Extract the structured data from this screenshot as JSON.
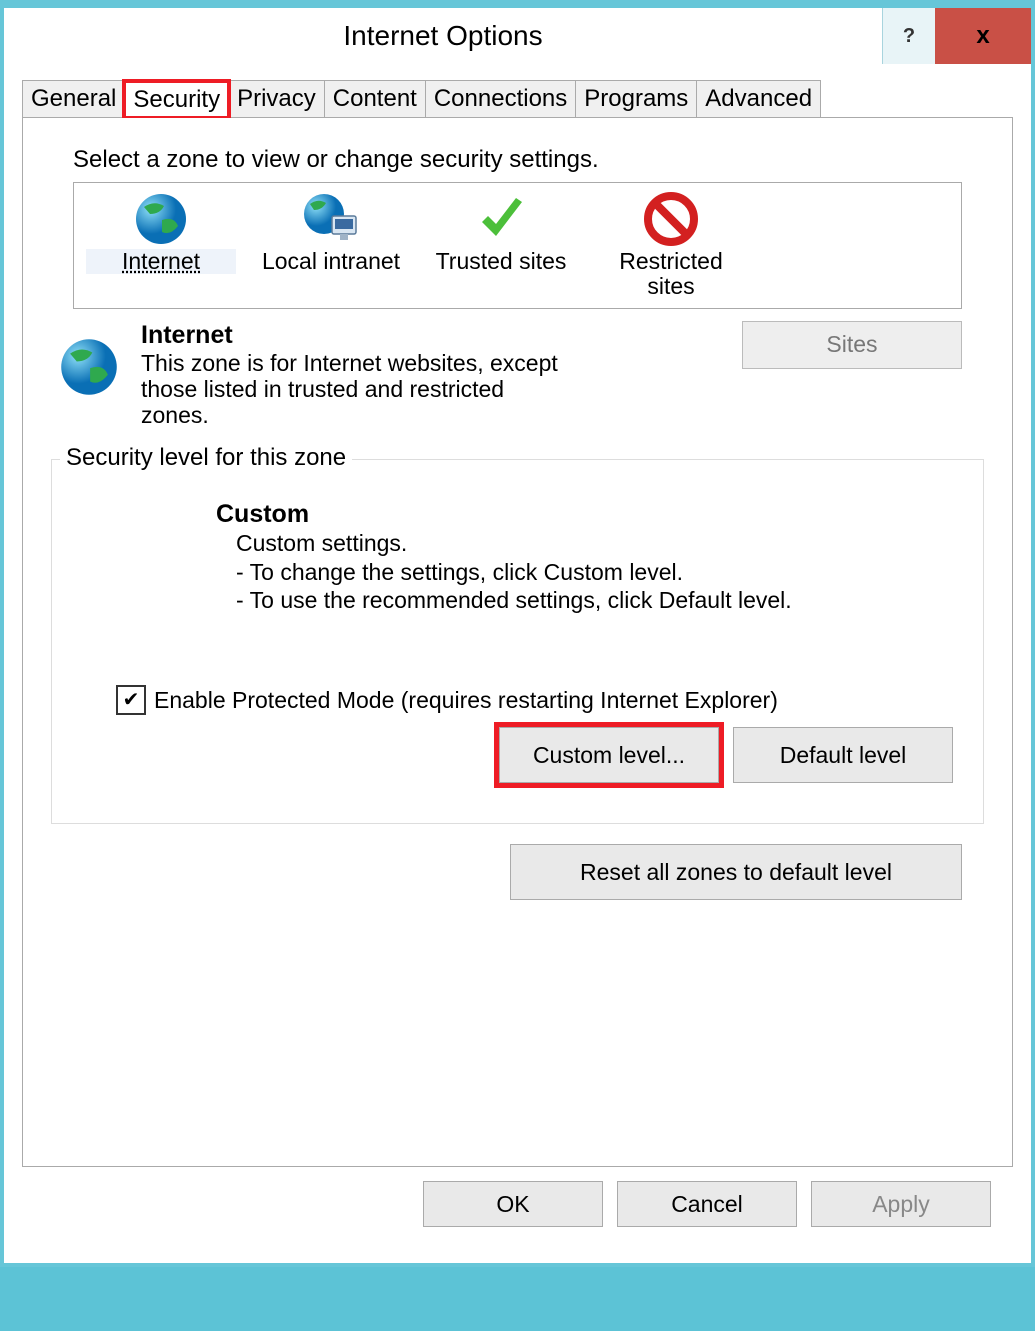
{
  "window": {
    "title": "Internet Options",
    "help": "?",
    "close": "x"
  },
  "tabs": {
    "general": "General",
    "security": "Security",
    "privacy": "Privacy",
    "content": "Content",
    "connections": "Connections",
    "programs": "Programs",
    "advanced": "Advanced",
    "active": "security",
    "highlighted": "security"
  },
  "zone_prompt": "Select a zone to view or change security settings.",
  "zones": {
    "internet": "Internet",
    "local_intranet": "Local intranet",
    "trusted_sites": "Trusted sites",
    "restricted_sites": "Restricted\nsites",
    "selected": "internet"
  },
  "description": {
    "title": "Internet",
    "body": "This zone is for Internet websites, except those listed in trusted and restricted zones."
  },
  "sites_button": "Sites",
  "security_level": {
    "legend": "Security level for this zone",
    "level_title": "Custom",
    "lines": [
      "Custom settings.",
      "- To change the settings, click Custom level.",
      "- To use the recommended settings, click Default level."
    ],
    "protected_mode_checked": true,
    "protected_mode_label": "Enable Protected Mode (requires restarting Internet Explorer)",
    "custom_level": "Custom level...",
    "default_level": "Default level",
    "reset": "Reset all zones to default level"
  },
  "dialog_buttons": {
    "ok": "OK",
    "cancel": "Cancel",
    "apply": "Apply"
  }
}
